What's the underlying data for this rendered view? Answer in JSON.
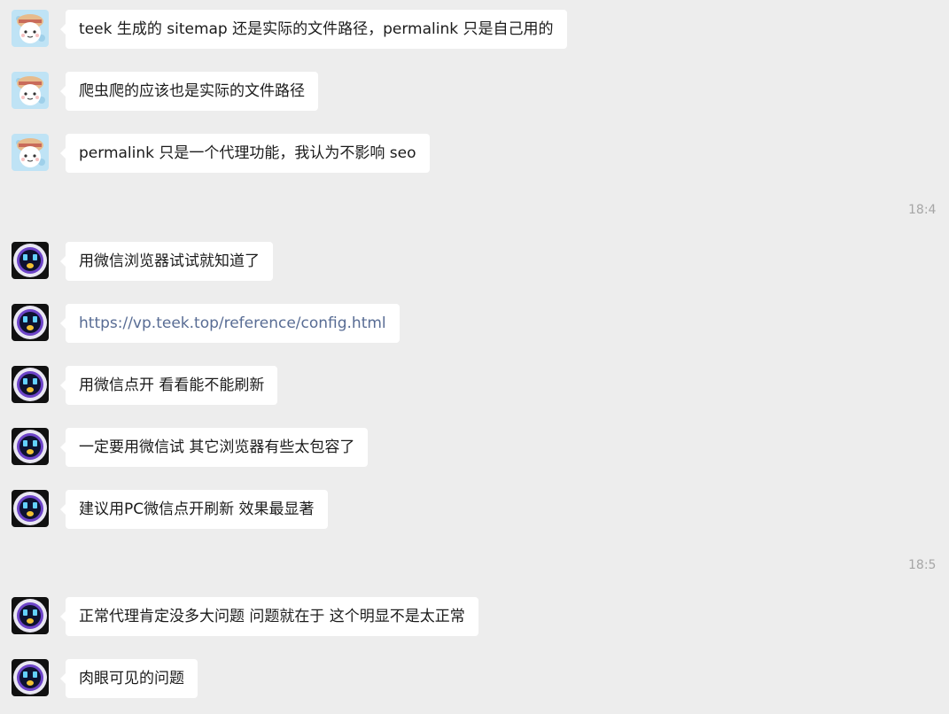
{
  "colors": {
    "background": "#ededed",
    "bubble": "#ffffff",
    "link": "#586c94",
    "timestamp": "#a6a6a6"
  },
  "messages": [
    {
      "avatar": "cartoon-girl-avatar",
      "text": "teek 生成的 sitemap 还是实际的文件路径，permalink 只是自己用的"
    },
    {
      "avatar": "cartoon-girl-avatar",
      "text": "爬虫爬的应该也是实际的文件路径"
    },
    {
      "avatar": "cartoon-girl-avatar",
      "text": "permalink 只是一个代理功能，我认为不影响 seo"
    },
    {
      "avatar": "robot-avatar",
      "text": "用微信浏览器试试就知道了"
    },
    {
      "avatar": "robot-avatar",
      "text": "https://vp.teek.top/reference/config.html",
      "is_link": true
    },
    {
      "avatar": "robot-avatar",
      "text": "用微信点开 看看能不能刷新"
    },
    {
      "avatar": "robot-avatar",
      "text": "一定要用微信试  其它浏览器有些太包容了"
    },
    {
      "avatar": "robot-avatar",
      "text": "建议用PC微信点开刷新 效果最显著"
    },
    {
      "avatar": "robot-avatar",
      "text": "正常代理肯定没多大问题 问题就在于 这个明显不是太正常"
    },
    {
      "avatar": "robot-avatar",
      "text": "肉眼可见的问题"
    }
  ],
  "timestamps": [
    "18:4",
    "18:5"
  ]
}
